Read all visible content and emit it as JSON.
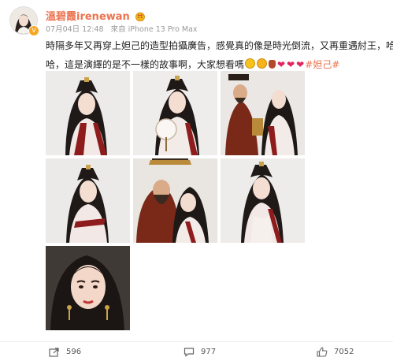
{
  "header": {
    "username": "溫碧霞irenewan",
    "date": "07月04日 12:48",
    "source": "來自 iPhone 13 Pro Max"
  },
  "post": {
    "line1": "時隔多年又再穿上妲己的造型拍攝廣告，感覺真的像是時光倒流，又再重遇紂王，哈",
    "line2_text": "哈，這是演繹的是不一樣的故事啊，大家想看嗎",
    "hashtag": "#妲己#"
  },
  "images": [
    {
      "id": "photo-1",
      "subject": "actress-portrait"
    },
    {
      "id": "photo-2",
      "subject": "actress-holding-fan"
    },
    {
      "id": "photo-3",
      "subject": "actress-with-king"
    },
    {
      "id": "photo-4",
      "subject": "actress-portrait-side"
    },
    {
      "id": "photo-5",
      "subject": "actress-with-king-close"
    },
    {
      "id": "photo-6",
      "subject": "actress-smiling"
    },
    {
      "id": "photo-7",
      "subject": "actress-closeup"
    }
  ],
  "footer": {
    "share_count": "596",
    "comment_count": "977",
    "like_count": "7052"
  },
  "colors": {
    "accent": "#eb7350",
    "heart": "#e0245e"
  }
}
